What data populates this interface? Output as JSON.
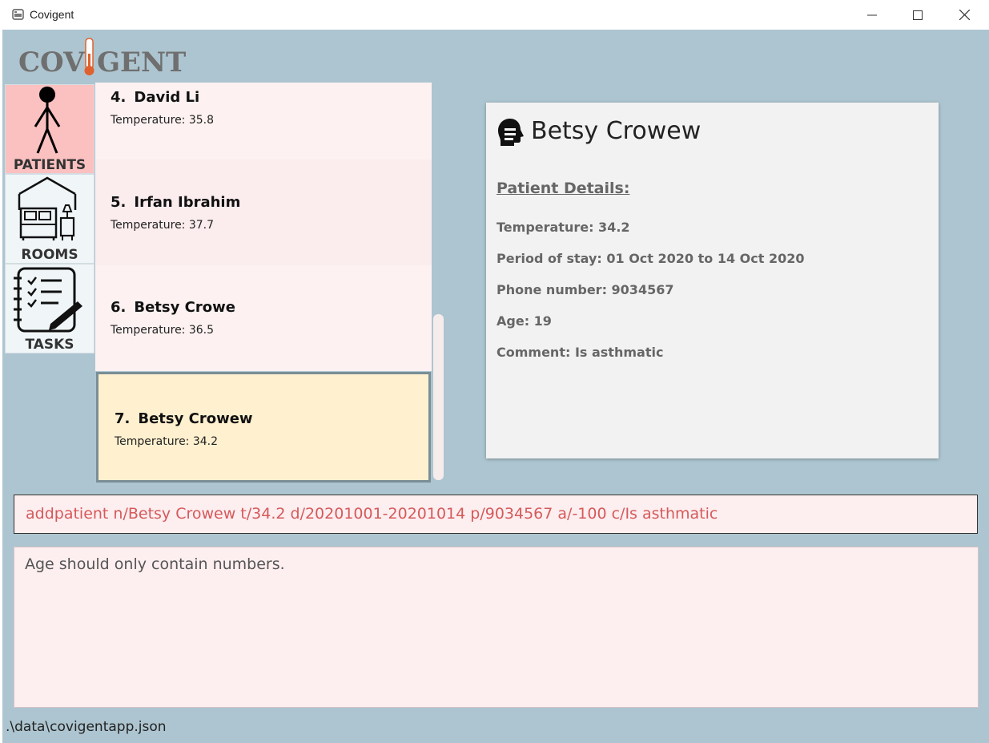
{
  "window": {
    "title": "Covigent"
  },
  "logo": {
    "text_left": "COV",
    "text_right": "GENT"
  },
  "nav": {
    "items": [
      {
        "label": "PATIENTS",
        "active": true
      },
      {
        "label": "ROOMS",
        "active": false
      },
      {
        "label": "TASKS",
        "active": false
      }
    ]
  },
  "patient_list": {
    "items": [
      {
        "index": "4.",
        "name": "David Li",
        "temperature": "Temperature: 35.8"
      },
      {
        "index": "5.",
        "name": "Irfan Ibrahim",
        "temperature": "Temperature: 37.7"
      },
      {
        "index": "6.",
        "name": "Betsy Crowe",
        "temperature": "Temperature: 36.5"
      },
      {
        "index": "7.",
        "name": "Betsy Crowew",
        "temperature": "Temperature: 34.2",
        "selected": true
      }
    ]
  },
  "detail": {
    "name": "Betsy Crowew",
    "section_title": "Patient Details:",
    "rows": [
      "Temperature: 34.2",
      "Period of stay: 01 Oct 2020 to 14 Oct 2020",
      "Phone number: 9034567",
      "Age: 19",
      "Comment: Is asthmatic"
    ]
  },
  "command": {
    "value": "addpatient n/Betsy Crowew t/34.2 d/20201001-20201014 p/9034567 a/-100 c/Is asthmatic"
  },
  "result": {
    "text": "Age should only contain numbers."
  },
  "status_bar": {
    "path": ".\\data\\covigentapp.json"
  },
  "colors": {
    "background": "#adc5d0",
    "active_nav": "#fbc0c0",
    "selected_card": "#fff0cf",
    "command_text": "#d55a5a",
    "thermometer": "#e0612d"
  },
  "icons": [
    "app-icon",
    "person-icon",
    "bedroom-icon",
    "checklist-icon",
    "patient-head-icon",
    "thermometer-icon"
  ]
}
